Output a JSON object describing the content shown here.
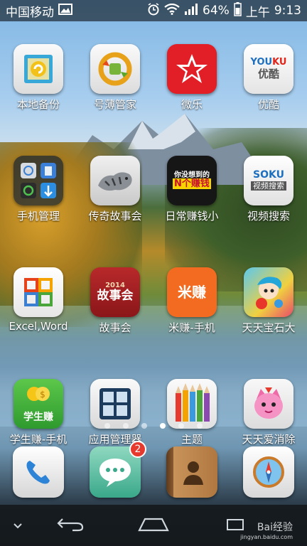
{
  "status_bar": {
    "carrier": "中国移动",
    "battery": "64%",
    "am_pm": "上午",
    "time": "9:13"
  },
  "apps": [
    {
      "label": "本地备份",
      "icon": "backup-icon"
    },
    {
      "label": "号薄管家",
      "icon": "contacts-sync-icon"
    },
    {
      "label": "微乐",
      "icon": "weile-icon"
    },
    {
      "label": "优酷",
      "icon": "youku-icon",
      "icon_text": "YOUKU\n优酷"
    },
    {
      "label": "手机管理",
      "icon": "phone-manager-folder-icon"
    },
    {
      "label": "传奇故事会",
      "icon": "tiger-icon"
    },
    {
      "label": "日常赚钱小",
      "icon": "earn-money-icon",
      "icon_text": "你没想到的\nN个赚钱"
    },
    {
      "label": "视频搜索",
      "icon": "soku-icon",
      "icon_text": "SOKU\n视频搜索"
    },
    {
      "label": "Excel,Word",
      "icon": "office-icon"
    },
    {
      "label": "故事会",
      "icon": "story-book-icon",
      "icon_text": "2014\n故事会"
    },
    {
      "label": "米赚-手机",
      "icon": "mizhuan-icon",
      "icon_text": "米赚"
    },
    {
      "label": "天天宝石大",
      "icon": "gem-game-icon"
    },
    {
      "label": "学生赚-手机",
      "icon": "student-earn-icon",
      "icon_text": "学生赚"
    },
    {
      "label": "应用管理器",
      "icon": "app-manager-icon"
    },
    {
      "label": "主题",
      "icon": "themes-icon"
    },
    {
      "label": "天天爱消除",
      "icon": "ttaxiaochu-icon"
    }
  ],
  "page_indicator": {
    "count": 6,
    "active": 4
  },
  "dock": [
    {
      "name": "phone",
      "icon": "phone-icon"
    },
    {
      "name": "messages",
      "icon": "message-icon",
      "badge": "2"
    },
    {
      "name": "contacts",
      "icon": "contacts-book-icon"
    },
    {
      "name": "browser",
      "icon": "compass-icon"
    }
  ],
  "navbar": {
    "watermark": "Bai经验",
    "watermark_url": "jingyan.baidu.com"
  },
  "colors": {
    "badge": "#e53a2d",
    "status_bar_bg": "#000000"
  }
}
